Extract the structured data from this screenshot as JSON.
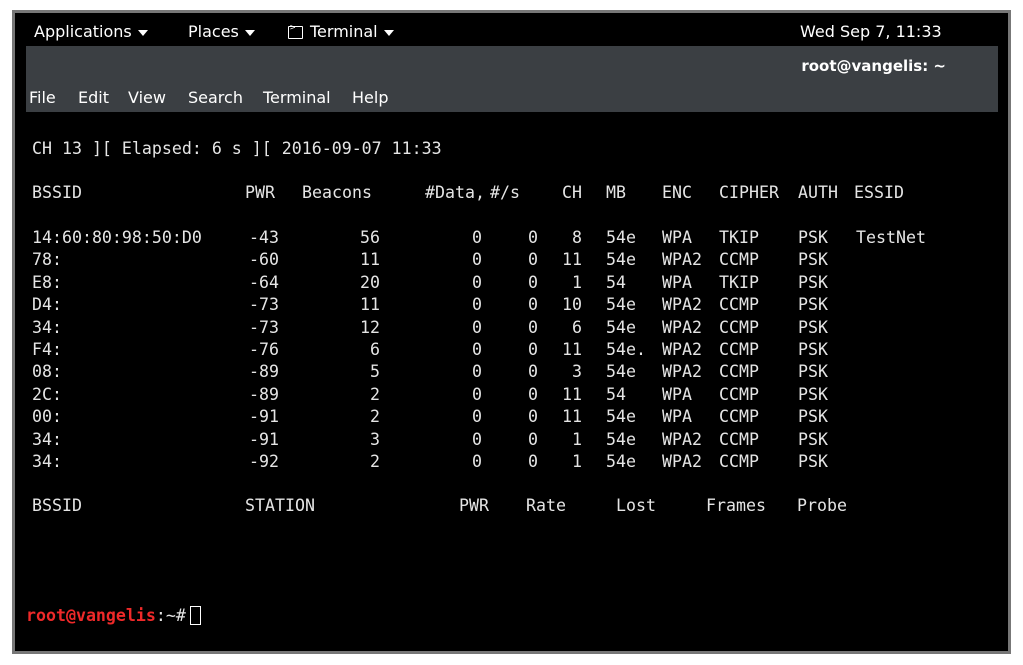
{
  "topbar": {
    "applications": "Applications",
    "places": "Places",
    "terminal": "Terminal",
    "clock": "Wed Sep  7, 11:33"
  },
  "window": {
    "title": "root@vangelis: ~"
  },
  "menu": [
    "File",
    "Edit",
    "View",
    "Search",
    "Terminal",
    "Help"
  ],
  "status_line": "CH 13 ][ Elapsed: 6 s ][ 2016-09-07 11:33",
  "ap_headers": [
    "BSSID",
    "PWR",
    "Beacons",
    "#Data,",
    "#/s",
    "CH",
    "MB",
    "ENC",
    "CIPHER",
    "AUTH",
    "ESSID"
  ],
  "ap_rows": [
    [
      "14:60:80:98:50:D0",
      "-43",
      "56",
      "0",
      "0",
      "8",
      "54e",
      "WPA",
      "TKIP",
      "PSK",
      "TestNet"
    ],
    [
      "78:",
      "-60",
      "11",
      "0",
      "0",
      "11",
      "54e",
      "WPA2",
      "CCMP",
      "PSK",
      ""
    ],
    [
      "E8:",
      "-64",
      "20",
      "0",
      "0",
      "1",
      "54",
      "WPA",
      "TKIP",
      "PSK",
      ""
    ],
    [
      "D4:",
      "-73",
      "11",
      "0",
      "0",
      "10",
      "54e",
      "WPA2",
      "CCMP",
      "PSK",
      ""
    ],
    [
      "34:",
      "-73",
      "12",
      "0",
      "0",
      "6",
      "54e",
      "WPA2",
      "CCMP",
      "PSK",
      ""
    ],
    [
      "F4:",
      "-76",
      "6",
      "0",
      "0",
      "11",
      "54e.",
      "WPA2",
      "CCMP",
      "PSK",
      ""
    ],
    [
      "08:",
      "-89",
      "5",
      "0",
      "0",
      "3",
      "54e",
      "WPA2",
      "CCMP",
      "PSK",
      ""
    ],
    [
      "2C:",
      "-89",
      "2",
      "0",
      "0",
      "11",
      "54",
      "WPA",
      "CCMP",
      "PSK",
      ""
    ],
    [
      "00:",
      "-91",
      "2",
      "0",
      "0",
      "11",
      "54e",
      "WPA",
      "CCMP",
      "PSK",
      ""
    ],
    [
      "34:",
      "-91",
      "3",
      "0",
      "0",
      "1",
      "54e",
      "WPA2",
      "CCMP",
      "PSK",
      ""
    ],
    [
      "34:",
      "-92",
      "2",
      "0",
      "0",
      "1",
      "54e",
      "WPA2",
      "CCMP",
      "PSK",
      ""
    ]
  ],
  "station_headers": [
    "BSSID",
    "STATION",
    "PWR",
    "Rate",
    "Lost",
    "Frames",
    "Probe"
  ],
  "prompt": {
    "user_host": "root@vangelis",
    "path": ":~#"
  },
  "colors": {
    "prompt": "#ef2929",
    "titlebar": "#3b3f43"
  }
}
